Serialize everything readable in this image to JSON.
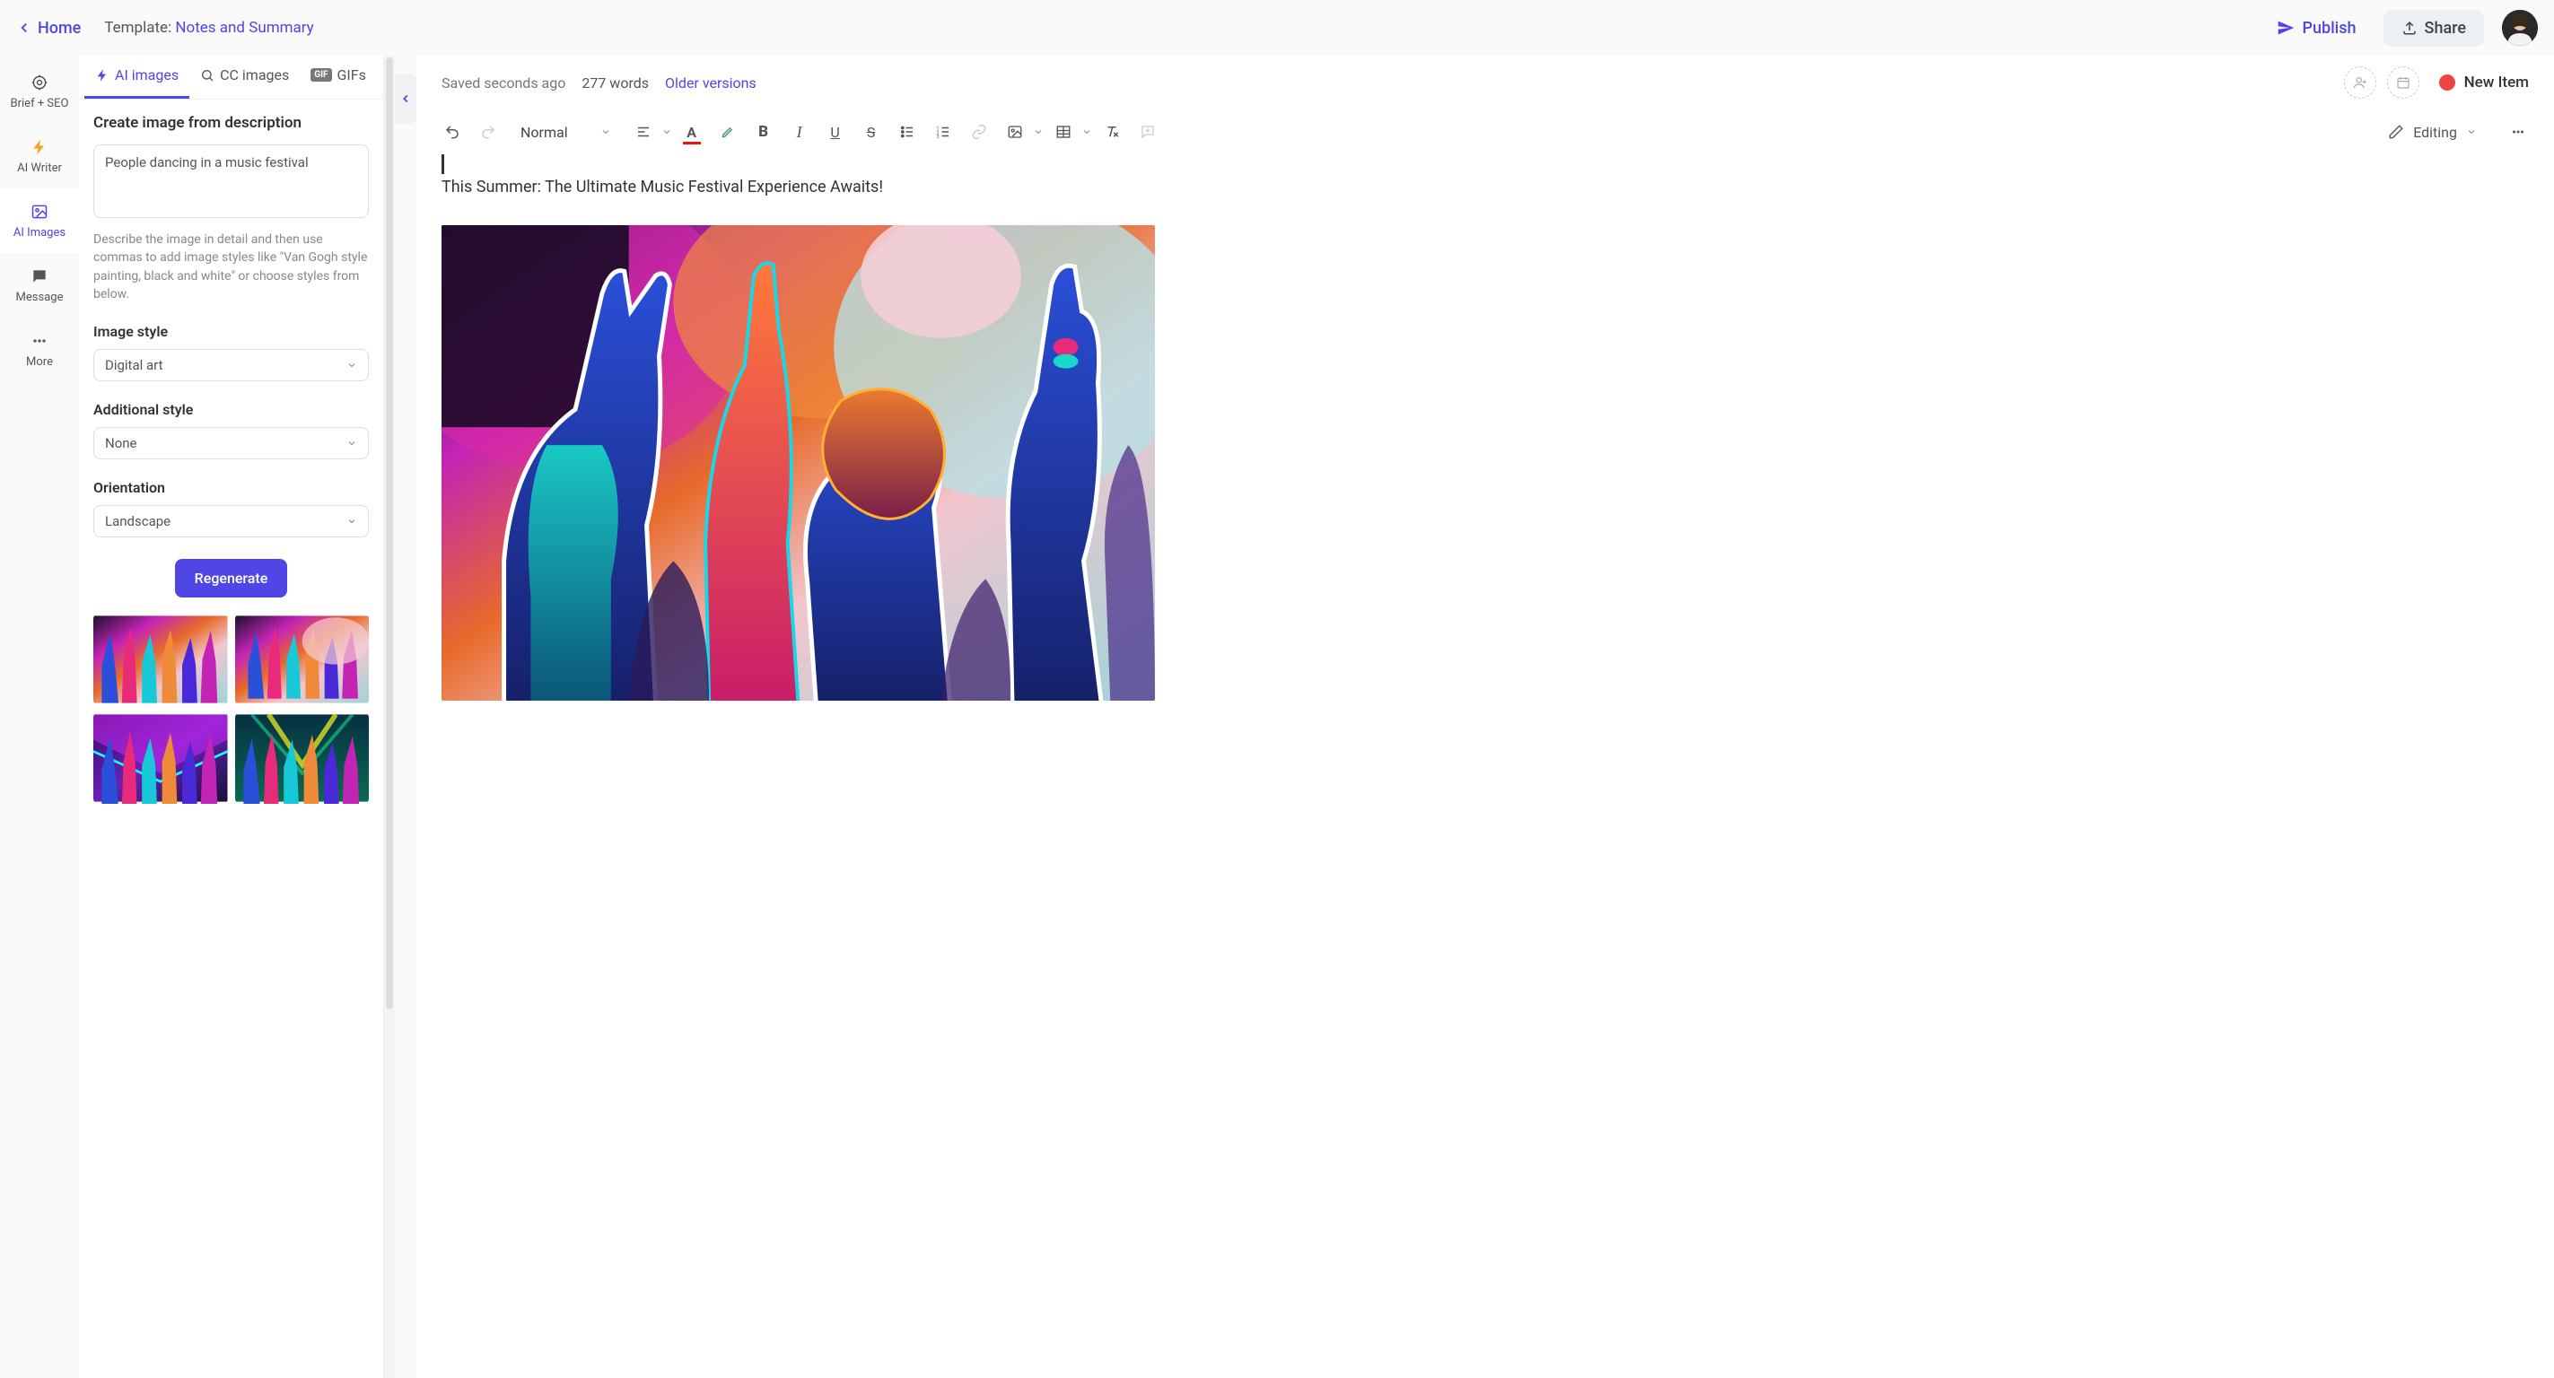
{
  "topbar": {
    "home": "Home",
    "template_label": "Template: ",
    "template_name": "Notes and Summary",
    "publish": "Publish",
    "share": "Share"
  },
  "rail": {
    "items": [
      {
        "label": "Brief + SEO"
      },
      {
        "label": "AI Writer"
      },
      {
        "label": "AI Images"
      },
      {
        "label": "Message"
      },
      {
        "label": "More"
      }
    ]
  },
  "panel": {
    "tabs": {
      "ai": "AI images",
      "cc": "CC images",
      "gifs": "GIFs"
    },
    "form_title": "Create image from description",
    "prompt": "People dancing in a music festival",
    "helper": "Describe the image in detail and then use commas to add image styles like \"Van Gogh style painting, black and white\" or choose styles from below.",
    "style_label": "Image style",
    "style_value": "Digital art",
    "add_style_label": "Additional style",
    "add_style_value": "None",
    "orient_label": "Orientation",
    "orient_value": "Landscape",
    "regenerate": "Regenerate"
  },
  "editor": {
    "saved": "Saved seconds ago",
    "words": "277 words",
    "older": "Older versions",
    "new_item": "New Item",
    "para_style": "Normal",
    "mode": "Editing",
    "headline": "This Summer: The Ultimate Music Festival Experience Awaits!"
  }
}
